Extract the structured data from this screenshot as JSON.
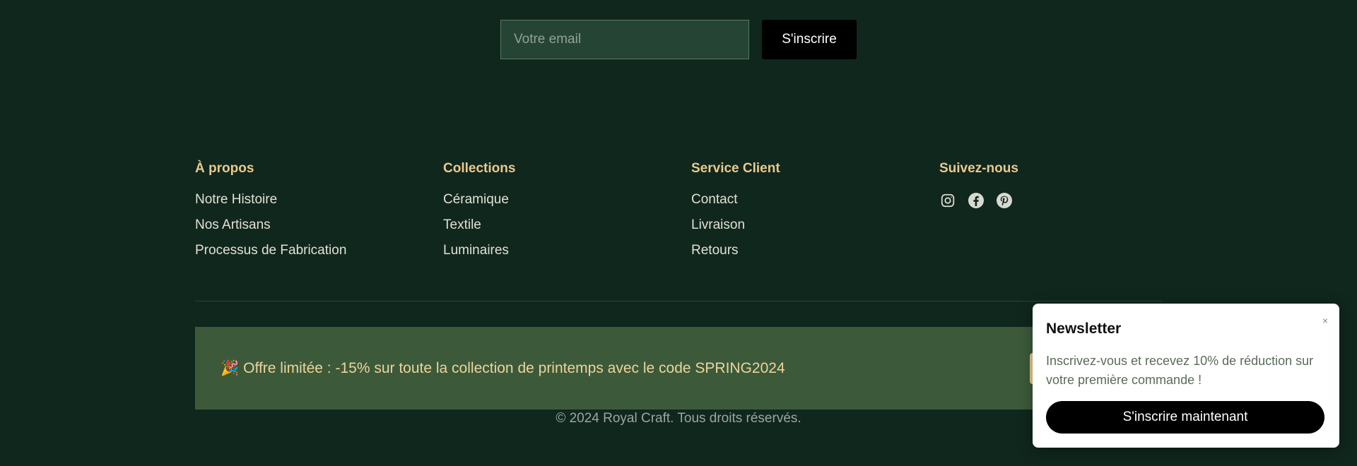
{
  "newsletter_form": {
    "email_placeholder": "Votre email",
    "submit_label": "S'inscrire"
  },
  "footer": {
    "columns": [
      {
        "heading": "À propos",
        "links": [
          "Notre Histoire",
          "Nos Artisans",
          "Processus de Fabrication"
        ]
      },
      {
        "heading": "Collections",
        "links": [
          "Céramique",
          "Textile",
          "Luminaires"
        ]
      },
      {
        "heading": "Service Client",
        "links": [
          "Contact",
          "Livraison",
          "Retours"
        ]
      },
      {
        "heading": "Suivez-nous",
        "socials": [
          "instagram-icon",
          "facebook-icon",
          "pinterest-icon"
        ]
      }
    ]
  },
  "promo": {
    "emoji": "🎉",
    "text": "Offre limitée : -15% sur toute la collection de printemps avec le code SPRING2024"
  },
  "copyright": "© 2024 Royal Craft. Tous droits réservés.",
  "popup": {
    "title": "Newsletter",
    "close": "×",
    "body": "Inscrivez-vous et recevez 10% de réduction sur votre première commande !",
    "cta": "S'inscrire maintenant"
  },
  "colors": {
    "background": "#10271d",
    "accent_gold": "#e9c98e",
    "promo_bg": "#3c5a3a"
  }
}
